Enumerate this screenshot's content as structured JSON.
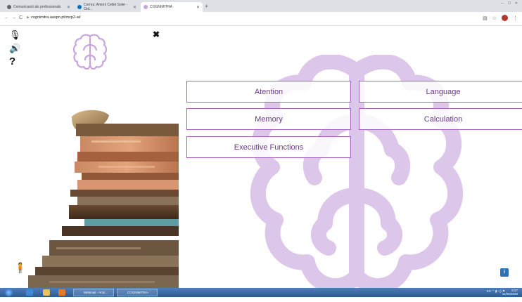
{
  "browser": {
    "tabs": [
      {
        "title": "Comunicació als professionals",
        "active": false,
        "favicon_color": "#5f6368"
      },
      {
        "title": "Correu: Antoni Cellet Soler - Out...",
        "active": false,
        "favicon_color": "#0072c6"
      },
      {
        "title": "COGNIMITRA",
        "active": true,
        "favicon_color": "#c9a3de"
      }
    ],
    "new_tab": "+",
    "window_controls": "— ☐ ✕",
    "url": "cognimitra.aaspn.pt/mvp2-ai/",
    "nav": {
      "back": "←",
      "forward": "→",
      "reload": "C"
    }
  },
  "page": {
    "controls": {
      "mic": "🎙",
      "sound": "🔊",
      "help": "?"
    },
    "close": "✖",
    "menu": {
      "attention": "Atention",
      "language": "Language",
      "memory": "Memory",
      "calculation": "Calculation",
      "executive": "Executive Functions"
    },
    "info": "i",
    "person": "🧍"
  },
  "colors": {
    "accent": "#a463bf",
    "accent_text": "#6c3a86",
    "brain_bg": "#dcc6ea",
    "logo_stroke": "#c9a3de"
  },
  "taskbar": {
    "tasks": [
      "Webmail - Anto...",
      "COGNIMITRA - Go..."
    ],
    "tray": "ES ⌃ ▮ ◁) ⚑",
    "time": "9:27",
    "date": "11/06/2020"
  }
}
